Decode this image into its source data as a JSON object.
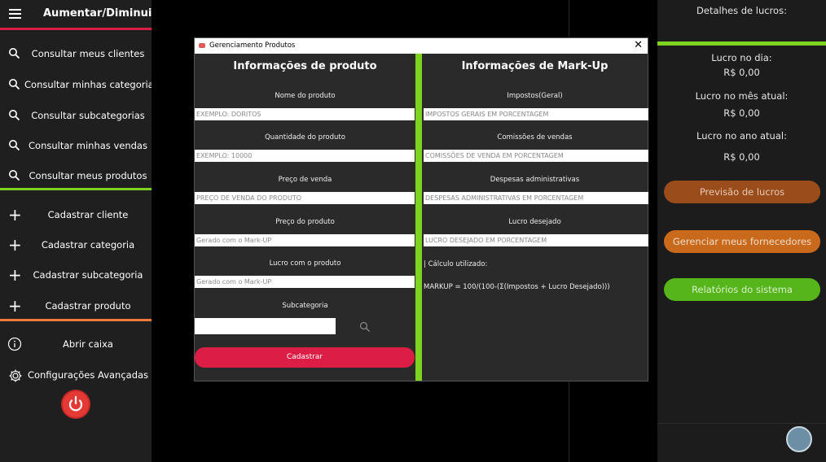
{
  "sidebar": {
    "title": "Aumentar/Diminuir",
    "search_items": [
      {
        "label": "Consultar meus clientes"
      },
      {
        "label": "Consultar minhas categorias"
      },
      {
        "label": "Consultar subcategorias"
      },
      {
        "label": "Consultar minhas vendas"
      },
      {
        "label": "Consultar meus produtos"
      }
    ],
    "add_items": [
      {
        "label": "Cadastrar cliente"
      },
      {
        "label": "Cadastrar categoria"
      },
      {
        "label": "Cadastrar subcategoria"
      },
      {
        "label": "Cadastrar produto"
      }
    ],
    "bottom_items": [
      {
        "label": "Abrir caixa"
      },
      {
        "label": "Configurações Avançadas"
      }
    ]
  },
  "right_panel": {
    "header": "Detalhes de lucros:",
    "day_label": "Lucro no dia:",
    "day_value": "R$ 0,00",
    "month_label": "Lucro no mês atual:",
    "month_value": "R$ 0,00",
    "year_label": "Lucro no ano atual:",
    "year_value": "R$ 0,00",
    "buttons": {
      "forecast": "Previsão de lucros",
      "suppliers": "Gerenciar meus fornecedores",
      "reports": "Relatórios do sistema"
    }
  },
  "modal": {
    "title": "Gerenciamento Produtos",
    "left_title": "Informações de produto",
    "right_title": "Informações de Mark-Up",
    "fields_left": [
      {
        "label": "Nome do produto",
        "value": "EXEMPLO: DORITOS"
      },
      {
        "label": "Quantidade do produto",
        "value": "EXEMPLO: 10000"
      },
      {
        "label": "Preço de venda",
        "value": "PREÇO DE VENDA DO PRODUTO"
      },
      {
        "label": "Preço do produto",
        "value": "Gerado com o Mark-UP"
      },
      {
        "label": "Lucro com o produto",
        "value": "Gerado com o Mark-UP"
      }
    ],
    "subcategory_label": "Subcategoria",
    "subcategory_value": "",
    "submit_label": "Cadastrar",
    "fields_right": [
      {
        "label": "Impostos(Geral)",
        "value": "IMPOSTOS GERAIS EM PORCENTAGEM"
      },
      {
        "label": "Comissões de vendas",
        "value": "COMISSÕES DE VENDA EM PORCENTAGEM"
      },
      {
        "label": "Despesas administrativas",
        "value": "DESPESAS ADMINISTRATIVAS EM PORCENTAGEM"
      },
      {
        "label": "Lucro desejado",
        "value": "LUCRO DESEJADO EM PORCENTAGEM"
      }
    ],
    "calc_label": "| Cálculo utilizado:",
    "calc_formula": "MARKUP = 100/(100-(Σ(Impostos + Lucro Desejado)))"
  },
  "colors": {
    "sidebar_top_sep": "#d91e46",
    "sidebar_mid_sep": "#7ed321",
    "sidebar_bottom_sep": "#f07a3c",
    "forecast_btn": "#9a4d1b",
    "suppliers_btn": "#c8691c",
    "reports_btn": "#55b51b",
    "submit_btn": "#dc1d45"
  }
}
